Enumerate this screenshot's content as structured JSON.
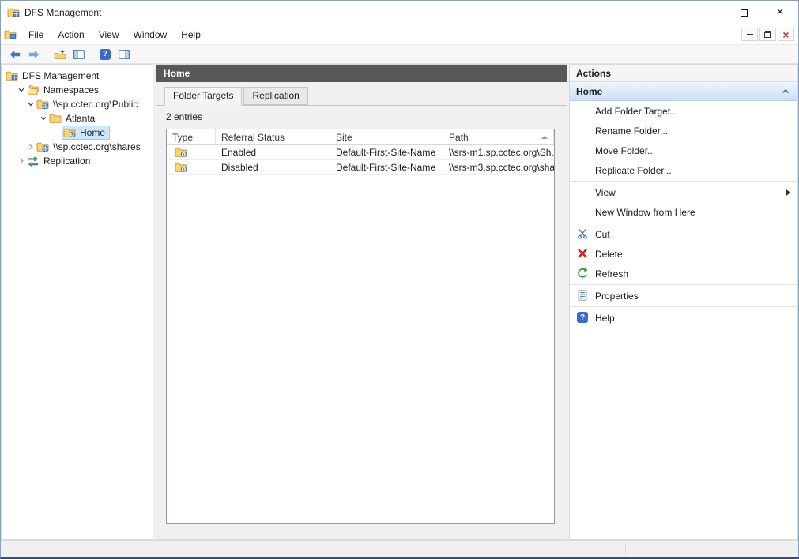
{
  "colors": {
    "result_header_bg": "#58585B",
    "tree_selection_bg": "#CCE8FF",
    "action_section_gradient_top": "#EFF6FD",
    "action_section_gradient_bottom": "#CBDFF4",
    "delete_icon_color": "#D11C1C",
    "refresh_icon_color": "#239A35",
    "help_icon_color": "#3A6BC4"
  },
  "glyphs": {
    "close": "×",
    "help": "?"
  },
  "window": {
    "title": "DFS Management"
  },
  "menubar": {
    "items": [
      {
        "label": "File"
      },
      {
        "label": "Action"
      },
      {
        "label": "View"
      },
      {
        "label": "Window"
      },
      {
        "label": "Help"
      }
    ]
  },
  "toolbar": {
    "buttons": [
      {
        "icon": "back-arrow-icon"
      },
      {
        "icon": "forward-arrow-icon"
      },
      {
        "icon": "up-one-level-icon"
      },
      {
        "icon": "show-hide-console-tree-icon"
      },
      {
        "icon": "help-icon"
      },
      {
        "icon": "show-hide-action-pane-icon"
      }
    ]
  },
  "tree": {
    "items": [
      {
        "label": "DFS Management",
        "level": 0,
        "icon": "dfs-management-icon",
        "expander": "none",
        "selected": false
      },
      {
        "label": "Namespaces",
        "level": 1,
        "icon": "namespaces-icon",
        "expander": "expanded",
        "selected": false
      },
      {
        "label": "\\\\sp.cctec.org\\Public",
        "level": 2,
        "icon": "namespace-icon",
        "expander": "expanded",
        "selected": false
      },
      {
        "label": "Atlanta",
        "level": 3,
        "icon": "folder-icon",
        "expander": "expanded",
        "selected": false
      },
      {
        "label": "Home",
        "level": 4,
        "icon": "dfs-folder-icon",
        "expander": "none",
        "selected": true
      },
      {
        "label": "\\\\sp.cctec.org\\shares",
        "level": 2,
        "icon": "namespace-icon",
        "expander": "collapsed",
        "selected": false
      },
      {
        "label": "Replication",
        "level": 1,
        "icon": "replication-icon",
        "expander": "collapsed",
        "selected": false
      }
    ]
  },
  "main": {
    "header_title": "Home",
    "tabs": [
      {
        "label": "Folder Targets",
        "active": true
      },
      {
        "label": "Replication",
        "active": false
      }
    ],
    "entries_label": "2 entries",
    "table": {
      "columns": [
        {
          "label": "Type"
        },
        {
          "label": "Referral Status"
        },
        {
          "label": "Site"
        },
        {
          "label": "Path",
          "sorted": "ascending"
        }
      ],
      "rows": [
        {
          "type_icon": "folder-target-icon",
          "referral_status": "Enabled",
          "site": "Default-First-Site-Name",
          "path": "\\\\srs-m1.sp.cctec.org\\Sh..."
        },
        {
          "type_icon": "folder-target-icon",
          "referral_status": "Disabled",
          "site": "Default-First-Site-Name",
          "path": "\\\\srs-m3.sp.cctec.org\\sha..."
        }
      ]
    }
  },
  "actions": {
    "title": "Actions",
    "section_title": "Home",
    "items": [
      {
        "label": "Add Folder Target..."
      },
      {
        "label": "Rename Folder..."
      },
      {
        "label": "Move Folder..."
      },
      {
        "label": "Replicate Folder..."
      },
      {
        "label": "View",
        "submenu": true
      },
      {
        "label": "New Window from Here"
      },
      {
        "label": "Cut",
        "icon": "cut-icon"
      },
      {
        "label": "Delete",
        "icon": "delete-icon"
      },
      {
        "label": "Refresh",
        "icon": "refresh-icon"
      },
      {
        "label": "Properties",
        "icon": "properties-icon"
      },
      {
        "label": "Help",
        "icon": "help-icon"
      }
    ]
  }
}
